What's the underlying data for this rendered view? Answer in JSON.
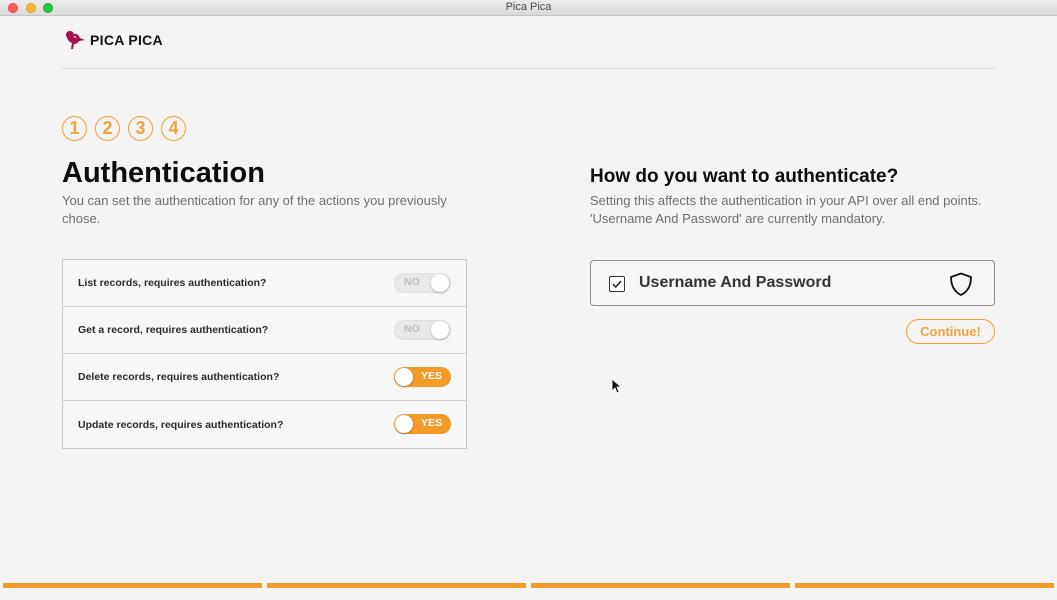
{
  "window": {
    "title": "Pica Pica"
  },
  "header": {
    "brand": "PICA PICA",
    "logo_icon": "bird-logo-icon"
  },
  "steps": [
    "1",
    "2",
    "3",
    "4"
  ],
  "left": {
    "title": "Authentication",
    "description": "You can set the authentication for any of the actions you previously chose.",
    "rows": [
      {
        "label": "List records, requires authentication?",
        "state": "NO"
      },
      {
        "label": "Get a record, requires authentication?",
        "state": "NO"
      },
      {
        "label": "Delete records, requires authentication?",
        "state": "YES"
      },
      {
        "label": "Update records, requires authentication?",
        "state": "YES"
      }
    ]
  },
  "right": {
    "title": "How do you want to authenticate?",
    "description": "Setting this affects the authentication in your API over all end points. 'Username And Password' are currently mandatory.",
    "method": {
      "label": "Username And Password",
      "checked": true,
      "icon": "shield-icon"
    },
    "continue_label": "Continue!"
  },
  "progress": {
    "segments": 4,
    "completed": 4
  },
  "colors": {
    "accent": "#f29b26",
    "step_outline": "#f0a23a",
    "logo": "#a3134f"
  }
}
